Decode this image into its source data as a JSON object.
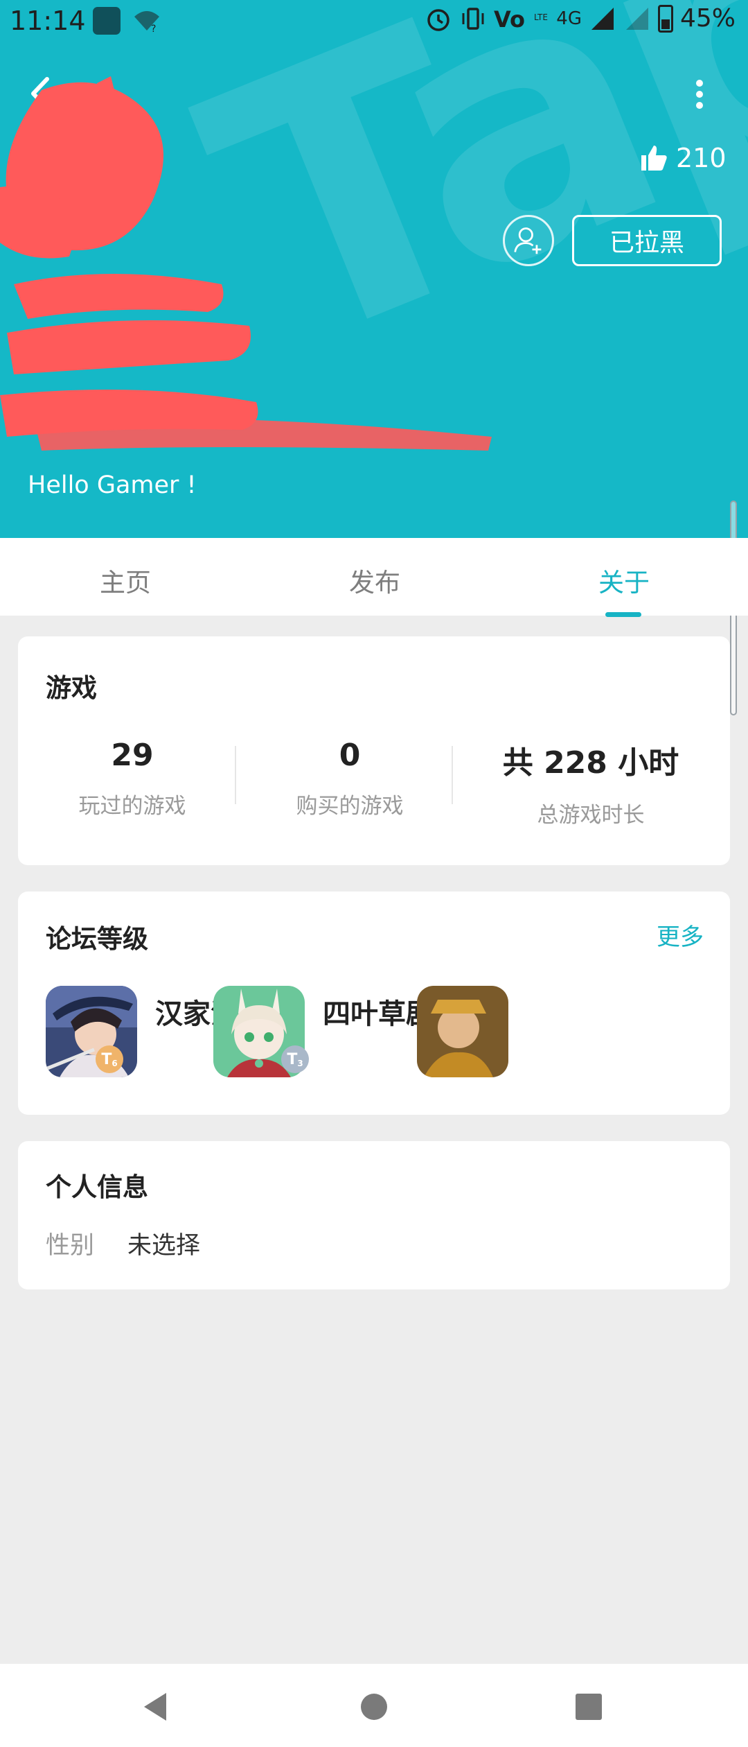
{
  "status_bar": {
    "time": "11:14",
    "battery": "45%",
    "network": "4G",
    "icons": [
      "app-icon",
      "wifi-icon",
      "alarm-icon",
      "vibrate-icon",
      "volte-icon",
      "signal-icon",
      "battery-icon"
    ]
  },
  "header": {
    "likes_count": "210",
    "block_button_label": "已拉黑",
    "bio": "Hello Gamer !",
    "bg_color": "#15b8c7"
  },
  "tabs": [
    {
      "label": "主页",
      "active": false
    },
    {
      "label": "发布",
      "active": false
    },
    {
      "label": "关于",
      "active": true
    }
  ],
  "games_card": {
    "title": "游戏",
    "stats": [
      {
        "value": "29",
        "label": "玩过的游戏"
      },
      {
        "value": "0",
        "label": "购买的游戏"
      },
      {
        "value": "共 228 小时",
        "label": "总游戏时长"
      }
    ]
  },
  "forum_card": {
    "title": "论坛等级",
    "more_label": "更多",
    "games": [
      {
        "name": "汉家江湖",
        "level": "6",
        "badge_color": "#f0b46a"
      },
      {
        "name": "四叶草剧场",
        "level": "3",
        "badge_color": "#a9b8c9"
      }
    ]
  },
  "profile_card": {
    "title": "个人信息",
    "gender_label": "性别",
    "gender_value": "未选择"
  },
  "colors": {
    "accent": "#17b3c4",
    "page_bg": "#ededed"
  }
}
